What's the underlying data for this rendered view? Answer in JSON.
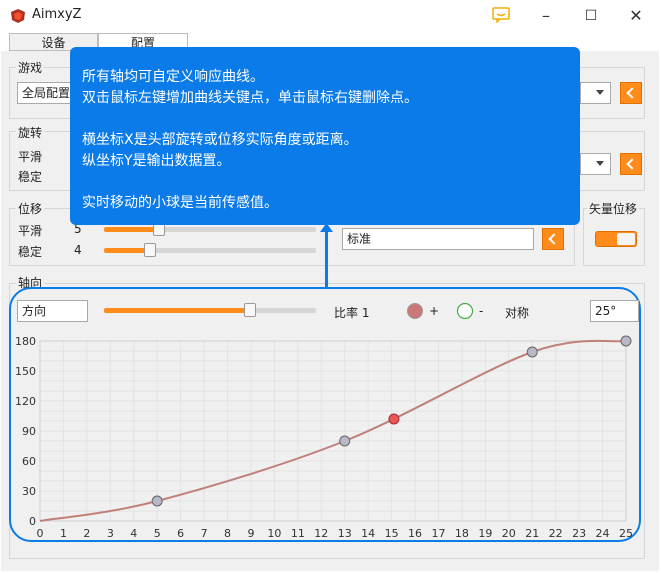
{
  "window": {
    "title": "AimxyZ",
    "minimize": "–",
    "maximize": "☐",
    "close": "✕"
  },
  "tabs": [
    {
      "label": "设备"
    },
    {
      "label": "配置"
    }
  ],
  "game_group": {
    "title": "游戏",
    "select_value": "全局配置"
  },
  "rotation_group": {
    "title": "旋转",
    "smooth_label": "平滑",
    "stable_label": "稳定"
  },
  "displacement_group": {
    "title": "位移",
    "smooth_label": "平滑",
    "smooth_value": "5",
    "stable_label": "稳定",
    "stable_value": "4",
    "preset_select": "标准"
  },
  "vector_group": {
    "title": "矢量位移"
  },
  "axis_group": {
    "title": "轴向",
    "direction_select": "方向",
    "ratio_label": "比率 1",
    "ratio_level": 0.69,
    "add_symbol": "+",
    "remove_symbol": "-",
    "symmetry_label": "对称",
    "angle_select": "25°"
  },
  "tooltip": {
    "lines": [
      "所有轴均可自定义响应曲线。",
      "双击鼠标左键增加曲线关键点，单击鼠标右键删除点。",
      "",
      "横坐标X是头部旋转或位移实际角度或距离。",
      "纵坐标Y是输出数据置。",
      "",
      "实时移动的小球是当前传感值。"
    ]
  },
  "colors": {
    "accent": "#ff8c1a",
    "highlight": "#0a7be8",
    "curve": "#c0807a",
    "keypoint": "#b8b8c8",
    "live_ball": "#ee5555"
  },
  "chart_data": {
    "type": "line",
    "xlim": [
      0,
      25
    ],
    "ylim": [
      0,
      180
    ],
    "x_ticks": [
      "0",
      "1",
      "2",
      "3",
      "4",
      "5",
      "6",
      "7",
      "8",
      "9",
      "10",
      "11",
      "12",
      "13",
      "14",
      "15",
      "16",
      "17",
      "18",
      "19",
      "20",
      "21",
      "22",
      "23",
      "24",
      "25"
    ],
    "y_ticks": [
      "0",
      "30",
      "60",
      "90",
      "120",
      "150",
      "180"
    ],
    "grid": true,
    "series": [
      {
        "keypoints": [
          {
            "x": 5,
            "y": 20
          },
          {
            "x": 13,
            "y": 80
          },
          {
            "x": 21,
            "y": 169
          },
          {
            "x": 25,
            "y": 180
          }
        ]
      }
    ],
    "live_point": {
      "x": 15.1,
      "y": 102
    }
  }
}
